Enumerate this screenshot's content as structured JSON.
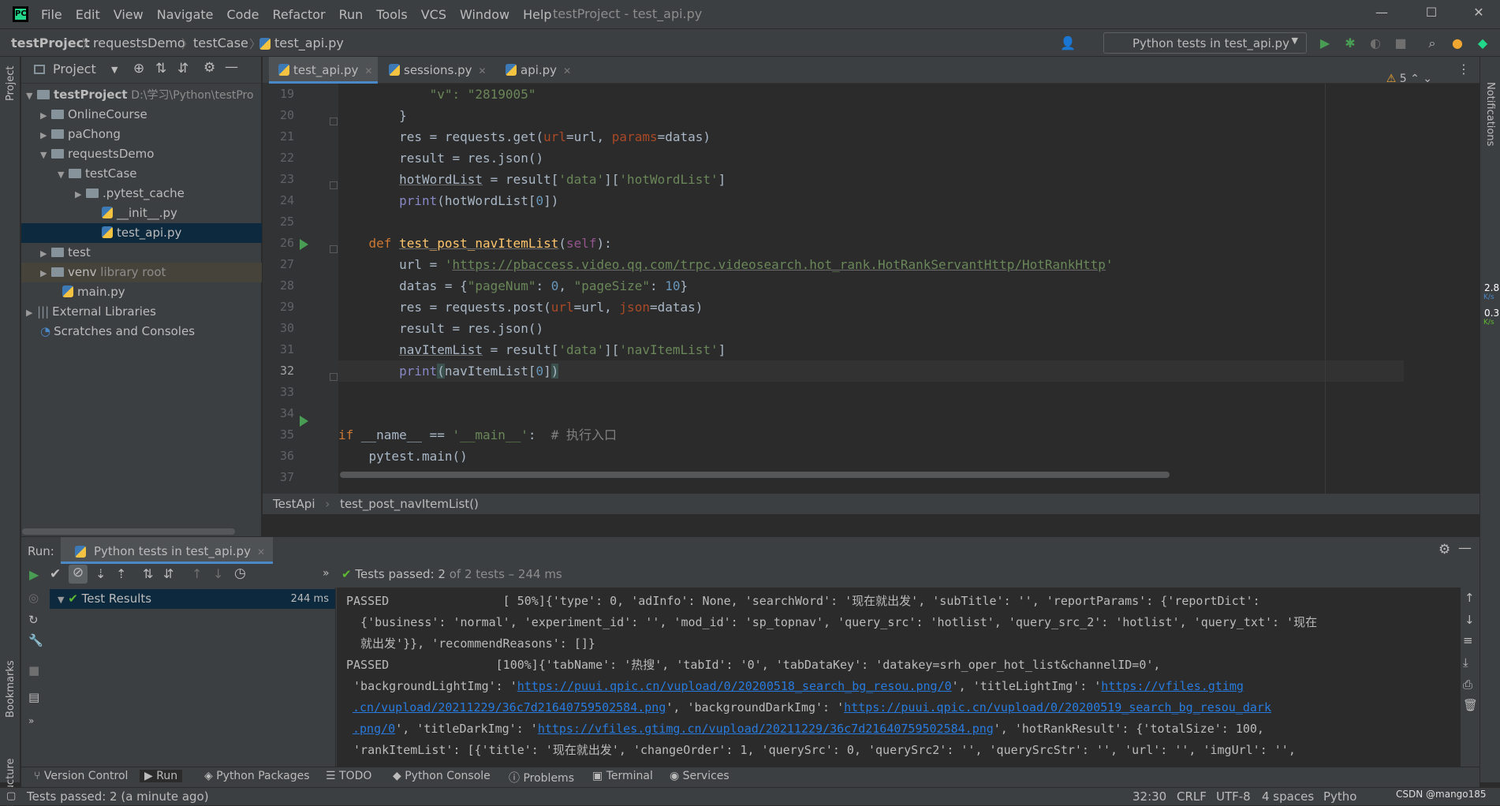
{
  "menu": {
    "items": [
      "File",
      "Edit",
      "View",
      "Navigate",
      "Code",
      "Refactor",
      "Run",
      "Tools",
      "VCS",
      "Window",
      "Help"
    ],
    "title": "testProject - test_api.py"
  },
  "breadcrumb": [
    "testProject",
    "requestsDemo",
    "testCase",
    "test_api.py"
  ],
  "run_config": "Python tests in test_api.py",
  "project": {
    "title": "Project",
    "root_name": "testProject",
    "root_path": "D:\\学习\\Python\\testPro",
    "items": [
      {
        "label": "OnlineCourse"
      },
      {
        "label": "paChong"
      },
      {
        "label": "requestsDemo"
      },
      {
        "label": "testCase"
      },
      {
        "label": ".pytest_cache"
      },
      {
        "label": "__init__.py"
      },
      {
        "label": "test_api.py"
      },
      {
        "label": "test"
      },
      {
        "label": "venv",
        "suffix": "library root"
      },
      {
        "label": "main.py"
      },
      {
        "label": "External Libraries"
      },
      {
        "label": "Scratches and Consoles"
      }
    ]
  },
  "tabs": [
    "test_api.py",
    "sessions.py",
    "api.py"
  ],
  "warnings": "5",
  "line_numbers": [
    "19",
    "20",
    "21",
    "22",
    "23",
    "24",
    "25",
    "26",
    "27",
    "28",
    "29",
    "30",
    "31",
    "32",
    "33",
    "34",
    "35",
    "36",
    "37"
  ],
  "code": {
    "l19": "\"v\": \"2819005\"",
    "l20": "}",
    "l21a": "res = requests.get(",
    "l21b": "url",
    "l21c": "=url, ",
    "l21d": "params",
    "l21e": "=datas)",
    "l22": "result = res.json()",
    "l23a": "hotWordList",
    "l23b": " = result[",
    "l23c": "'data'",
    "l23d": "][",
    "l23e": "'hotWordList'",
    "l23f": "]",
    "l24a": "print",
    "l24b": "(hotWordList[",
    "l24c": "0",
    "l24d": "])",
    "l26a": "def ",
    "l26b": "test_post_navItemList",
    "l26c": "(",
    "l26d": "self",
    "l26e": "):",
    "l27a": "url = ",
    "l27b": "'",
    "l27c": "https://pbaccess.video.qq.com/trpc.videosearch.hot_rank.HotRankServantHttp/HotRankHttp",
    "l27d": "'",
    "l28a": "datas = {",
    "l28b": "\"pageNum\"",
    "l28c": ": ",
    "l28d": "0",
    "l28e": ", ",
    "l28f": "\"pageSize\"",
    "l28g": ": ",
    "l28h": "10",
    "l28i": "}",
    "l29a": "res = requests.post(",
    "l29b": "url",
    "l29c": "=url, ",
    "l29d": "json",
    "l29e": "=datas)",
    "l30": "result = res.json()",
    "l31a": "navItemList",
    "l31b": " = result[",
    "l31c": "'data'",
    "l31d": "][",
    "l31e": "'navItemList'",
    "l31f": "]",
    "l32a": "print",
    "l32b": "(",
    "l32c": "navItemList[",
    "l32d": "0",
    "l32e": "]",
    "l32f": ")",
    "l35a": "if ",
    "l35b": "__name__ == ",
    "l35c": "'__main__'",
    "l35d": ":  ",
    "l35e": "# 执行入口",
    "l36": "pytest.main()"
  },
  "editor_breadcrumb": [
    "TestApi",
    "test_post_navItemList()"
  ],
  "run": {
    "label": "Run:",
    "tab": "Python tests in test_api.py",
    "status_bold": "Tests passed: 2",
    "status_rest": " of 2 tests – 244 ms",
    "tree_item": "Test Results",
    "tree_time": "244 ms",
    "console": [
      "PASSED                [ 50%]{'type': 0, 'adInfo': None, 'searchWord': '现在就出发', 'subTitle': '', 'reportParams': {'reportDict':",
      "  {'business': 'normal', 'experiment_id': '', 'mod_id': 'sp_topnav', 'query_src': 'hotlist', 'query_src_2': 'hotlist', 'query_txt': '现在",
      "  就出发'}}, 'recommendReasons': []}",
      "PASSED               [100%]{'tabName': '热搜', 'tabId': '0', 'tabDataKey': 'datakey=srh_oper_hot_list&channelID=0',"
    ],
    "c5a": " 'backgroundLightImg': '",
    "c5b": "https://puui.qpic.cn/vupload/0/20200518_search_bg_resou.png/0",
    "c5c": "', 'titleLightImg': '",
    "c5d": "https://vfiles.gtimg",
    "c6a": ".cn/vupload/20211229/36c7d21640759502584.png",
    "c6b": "', 'backgroundDarkImg': '",
    "c6c": "https://puui.qpic.cn/vupload/0/20200519_search_bg_resou_dark",
    "c7a": ".png/0",
    "c7b": "', 'titleDarkImg': '",
    "c7c": "https://vfiles.gtimg.cn/vupload/20211229/36c7d21640759502584.png",
    "c7d": "', 'hotRankResult': {'totalSize': 100,",
    "c8": " 'rankItemList': [{'title': '现在就出发', 'changeOrder': 1, 'querySrc': 0, 'querySrc2': '', 'querySrcStr': '', 'url': '', 'imgUrl': '',"
  },
  "bottom_tabs": [
    "Version Control",
    "Run",
    "Python Packages",
    "TODO",
    "Python Console",
    "Problems",
    "Terminal",
    "Services"
  ],
  "side_labels": {
    "project": "Project",
    "bookmarks": "Bookmarks",
    "structure": "Structure",
    "notifications": "Notifications"
  },
  "net": {
    "up": "2.8",
    "down": "0.3",
    "unit": "K/s"
  },
  "status": {
    "message": "Tests passed: 2 (a minute ago)",
    "position": "32:30",
    "line_sep": "CRLF",
    "encoding": "UTF-8",
    "indent": "4 spaces",
    "interpreter": "Pytho",
    "watermark": "CSDN @mango185"
  }
}
